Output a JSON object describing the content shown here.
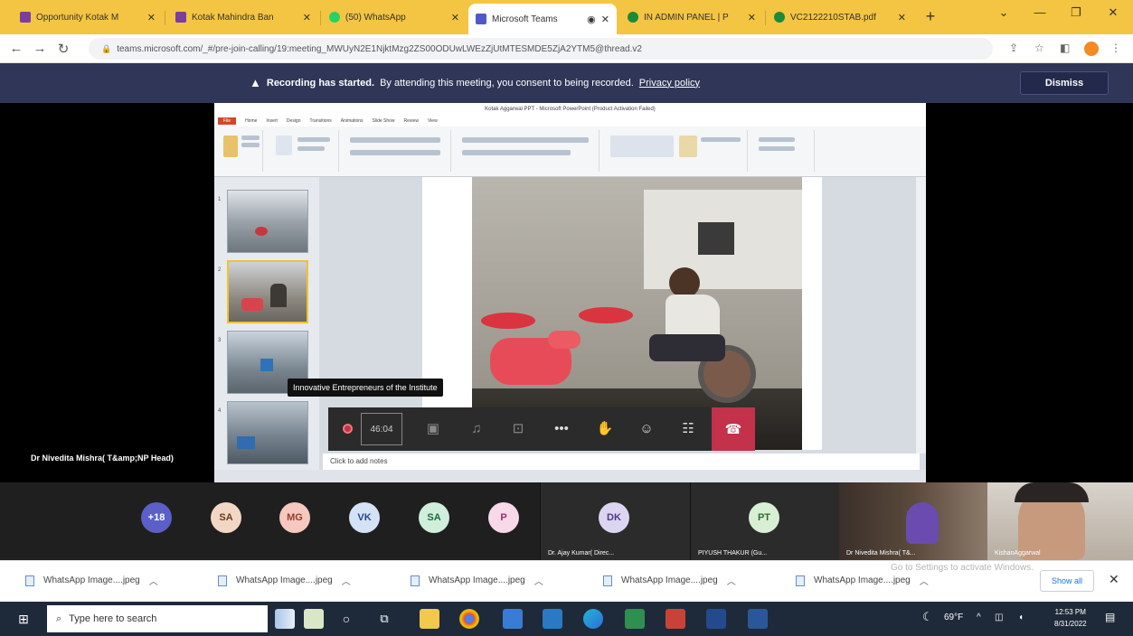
{
  "browser": {
    "tabs": [
      {
        "label": "Opportunity Kotak M",
        "fav_color": "#7a3e9d"
      },
      {
        "label": "Kotak Mahindra Ban",
        "fav_color": "#7a3e9d"
      },
      {
        "label": "(50) WhatsApp",
        "fav_color": "#25d366"
      },
      {
        "label": "Microsoft Teams",
        "fav_color": "#5059c9"
      },
      {
        "label": "IN ADMIN PANEL | P",
        "fav_color": "#1b8a3b"
      },
      {
        "label": "VC2122210STAB.pdf",
        "fav_color": "#1b8a3b"
      }
    ],
    "new_tab": "+",
    "url": "teams.microsoft.com/_#/pre-join-calling/19:meeting_MWUyN2E1NjktMzg2ZS00ODUwLWEzZjUtMTESMDE5ZjA2YTM5@thread.v2"
  },
  "banner": {
    "bold": "Recording has started.",
    "text": "By attending this meeting, you consent to being recorded.",
    "link": "Privacy policy",
    "dismiss": "Dismiss"
  },
  "ppt": {
    "title": "Kotak Aggarwal PPT - Microsoft PowerPoint (Product Activation Failed)",
    "tabs": [
      "File",
      "Home",
      "Insert",
      "Design",
      "Transitions",
      "Animations",
      "Slide Show",
      "Review",
      "View"
    ],
    "notes_placeholder": "Click to add notes"
  },
  "meeting": {
    "tooltip": "Innovative Entrepreneurs of the Institute",
    "timer": "46:04",
    "presenter": "Dr Nivedita Mishra( T&amp;NP Head)"
  },
  "roster": {
    "avatars": [
      {
        "initials": "+18",
        "bg": "#5b5fc7",
        "fg": "#ffffff"
      },
      {
        "initials": "SA",
        "bg": "#f2d7c5",
        "fg": "#6b3a1f"
      },
      {
        "initials": "MG",
        "bg": "#f6c8bf",
        "fg": "#9b3b2a"
      },
      {
        "initials": "VK",
        "bg": "#d5e2f6",
        "fg": "#27488a"
      },
      {
        "initials": "SA",
        "bg": "#cfeedc",
        "fg": "#1d6b43"
      },
      {
        "initials": "P",
        "bg": "#f7d9e9",
        "fg": "#9b2f6a"
      }
    ],
    "tiles": [
      {
        "initials": "DK",
        "bg": "#dcd5f2",
        "fg": "#4b3a8a",
        "name": "Dr. Ajay Kumar( Direc..."
      },
      {
        "initials": "PT",
        "bg": "#d8efd6",
        "fg": "#2f6b2a",
        "name": "PIYUSH THAKUR (Gu..."
      }
    ],
    "cams": [
      {
        "name": "Dr Nivedita Mishra( T&..."
      },
      {
        "name": "KishanAggarwal"
      }
    ]
  },
  "downloads": {
    "items": [
      "WhatsApp Image....jpeg",
      "WhatsApp Image....jpeg",
      "WhatsApp Image....jpeg",
      "WhatsApp Image....jpeg",
      "WhatsApp Image....jpeg"
    ],
    "show_all": "Show all",
    "activation_watermark": "Go to Settings to activate Windows."
  },
  "taskbar": {
    "search_placeholder": "Type here to search",
    "weather": "69°F",
    "time": "12:53 PM",
    "date": "8/31/2022"
  }
}
